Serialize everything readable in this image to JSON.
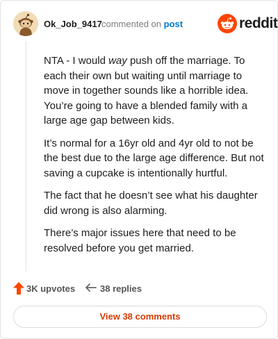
{
  "comment": {
    "username": "Ok_Job_9417",
    "action_text": "commented on",
    "post_link": "post",
    "paragraphs": [
      {
        "before": "NTA - I would ",
        "em": "way",
        "after": " push off the marriage. To each their own but waiting until marriage to move in together sounds like a horrible idea. You’re going to have a blended family with a large age gap between kids."
      },
      {
        "before": "It’s normal for a 16yr old and 4yr old to not be the best due to the large age difference. But not saving a cupcake is intentionally hurtful.",
        "em": "",
        "after": ""
      },
      {
        "before": "The fact that he doesn’t see what his daughter did wrong is also alarming.",
        "em": "",
        "after": ""
      },
      {
        "before": "There’s major issues here that need to be resolved before you get married.",
        "em": "",
        "after": ""
      }
    ]
  },
  "brand": {
    "wordmark": "reddit",
    "color": "#ff4500"
  },
  "actions": {
    "upvotes_label": "3K upvotes",
    "replies_label": "38 replies",
    "view_comments_label": "View 38 comments"
  },
  "icons": [
    "snoo-avatar-icon",
    "reddit-logo-icon",
    "upvote-arrow-icon",
    "reply-arrow-icon"
  ],
  "colors": {
    "accent": "#ff4500",
    "link": "#0079d3",
    "button_text": "#d93a00"
  }
}
